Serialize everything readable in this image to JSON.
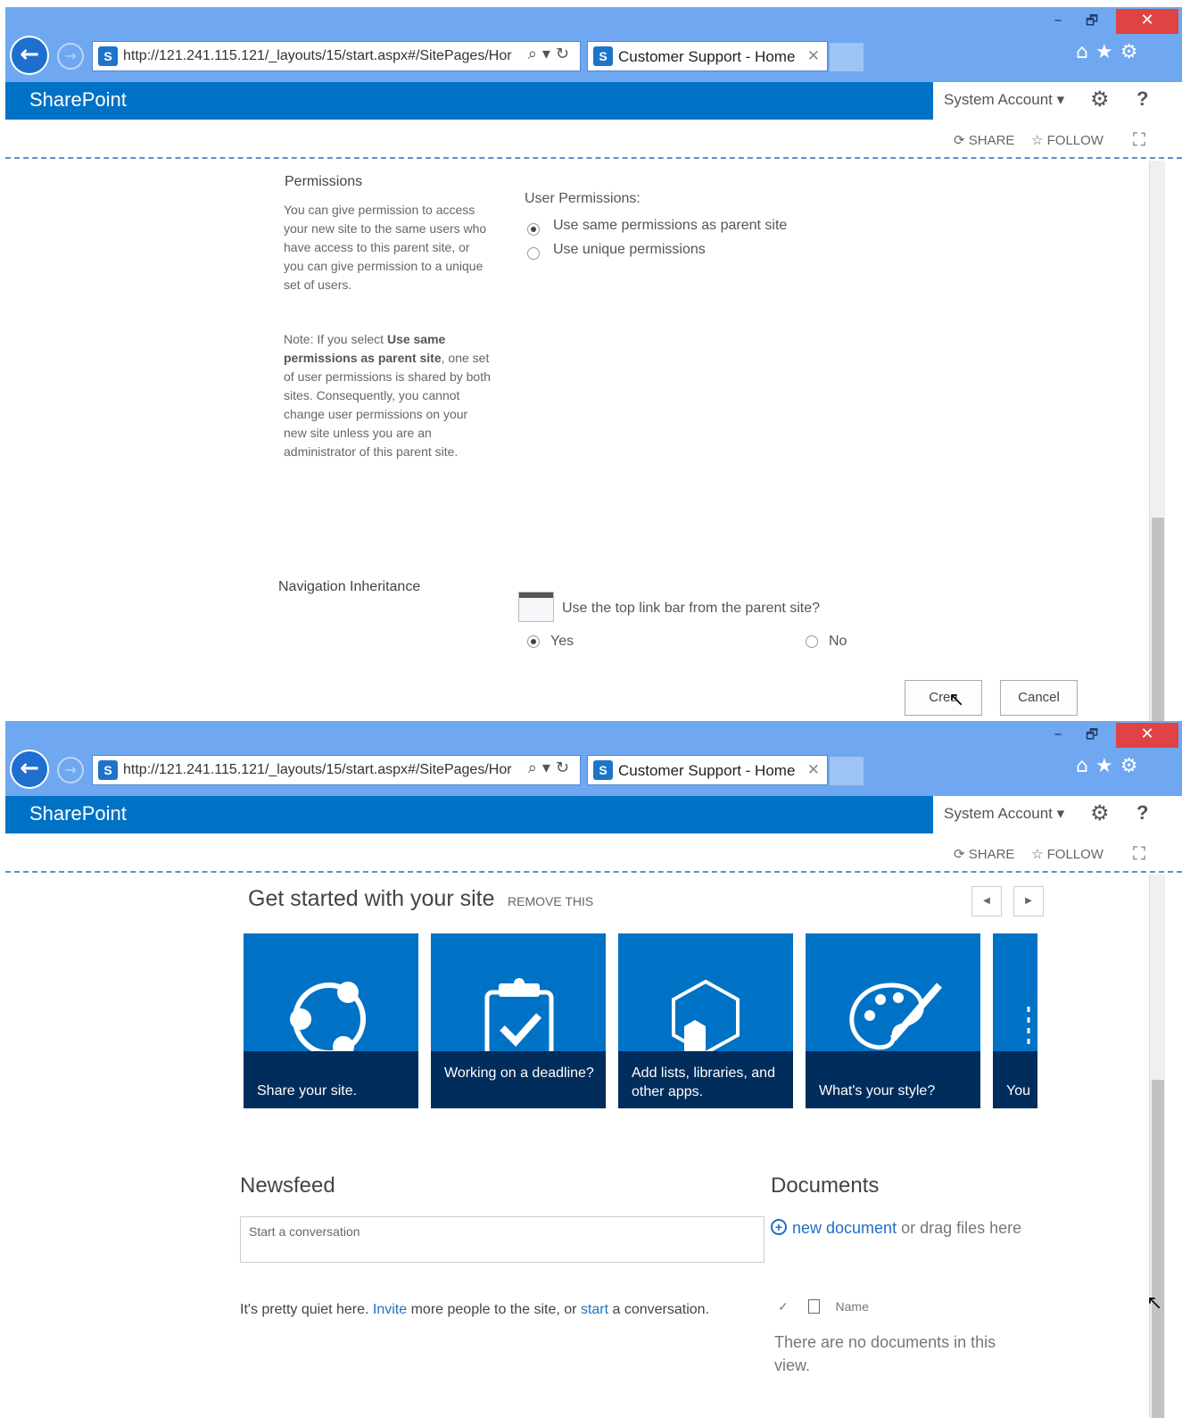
{
  "screens": [
    {
      "window": {
        "minimize": "–",
        "maximize": "🗗",
        "close": "✕"
      },
      "browser": {
        "url": "http://121.241.115.121/_layouts/15/start.aspx#/SitePages/Hor",
        "tab_title": "Customer Support - Home",
        "favicon": "S",
        "tab_close": "✕"
      },
      "suite": {
        "brand": "SharePoint",
        "account": "System Account ▾"
      },
      "commands": {
        "share": "SHARE",
        "follow": "FOLLOW"
      },
      "form": {
        "permissions_title": "Permissions",
        "permissions_desc": "You can give permission to access your new site to the same users who have access to this parent site, or you can give permission to a unique set of users.",
        "note_prefix": "Note: If you select ",
        "note_bold": "Use same permissions as parent site",
        "note_suffix": ", one set of user permissions is shared by both sites. Consequently, you cannot change user permissions on your new site unless you are an administrator of this parent site.",
        "user_permissions_label": "User Permissions:",
        "option_same": "Use same permissions as parent site",
        "option_unique": "Use unique permissions",
        "selected_permission": "same",
        "nav_title": "Navigation Inheritance",
        "nav_question": "Use the top link bar from the parent site?",
        "yes": "Yes",
        "no": "No",
        "selected_nav": "yes",
        "create_button": "Crea",
        "cancel_button": "Cancel"
      }
    },
    {
      "window": {
        "minimize": "–",
        "maximize": "🗗",
        "close": "✕"
      },
      "browser": {
        "url": "http://121.241.115.121/_layouts/15/start.aspx#/SitePages/Hor",
        "tab_title": "Customer Support - Home",
        "favicon": "S",
        "tab_close": "✕"
      },
      "suite": {
        "brand": "SharePoint",
        "account": "System Account ▾"
      },
      "commands": {
        "share": "SHARE",
        "follow": "FOLLOW"
      },
      "get_started": {
        "title": "Get started with your site",
        "remove": "REMOVE THIS",
        "prev": "◀",
        "next": "▶",
        "tiles": [
          {
            "caption": "Share your site.",
            "icon": "share-icon"
          },
          {
            "caption": "Working on a deadline?",
            "icon": "clipboard-check-icon"
          },
          {
            "caption": "Add lists, libraries, and other apps.",
            "icon": "apps-icon"
          },
          {
            "caption": "What's your style?",
            "icon": "palette-icon"
          },
          {
            "caption": "You",
            "icon": "partial-tile-icon"
          }
        ]
      },
      "newsfeed": {
        "title": "Newsfeed",
        "placeholder": "Start a conversation",
        "quiet_prefix": "It's pretty quiet here. ",
        "invite": "Invite",
        "quiet_mid": " more people to the site, or ",
        "start": "start",
        "quiet_suffix": " a conversation."
      },
      "documents": {
        "title": "Documents",
        "new_document": "new document",
        "drag_text": " or drag files here",
        "check": "✓",
        "name_header": "Name",
        "empty": "There are no documents in this view."
      }
    }
  ]
}
